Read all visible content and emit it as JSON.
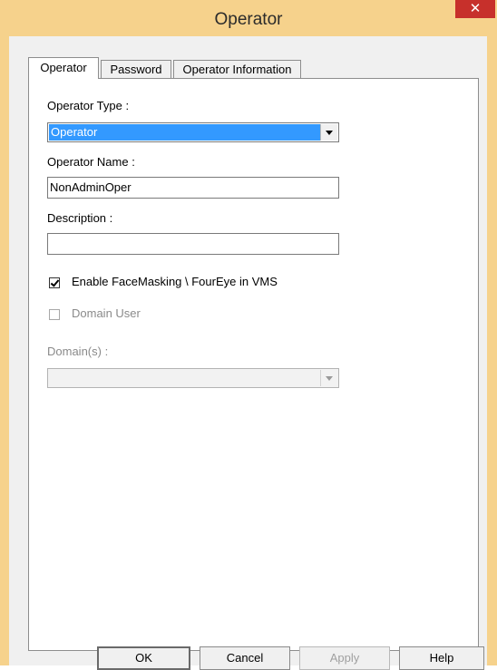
{
  "window": {
    "title": "Operator",
    "close_glyph": "✕"
  },
  "tabs": [
    {
      "label": "Operator",
      "active": true
    },
    {
      "label": "Password",
      "active": false
    },
    {
      "label": "Operator Information",
      "active": false
    }
  ],
  "form": {
    "operator_type": {
      "label": "Operator Type :",
      "value": "Operator"
    },
    "operator_name": {
      "label": "Operator Name :",
      "value": "NonAdminOper"
    },
    "description": {
      "label": "Description :",
      "value": ""
    },
    "face_masking": {
      "label": "Enable FaceMasking \\ FourEye in VMS",
      "checked": true
    },
    "domain_user": {
      "label": "Domain User",
      "checked": false,
      "enabled": false
    },
    "domains": {
      "label": "Domain(s) :",
      "value": "",
      "enabled": false
    }
  },
  "buttons": {
    "ok": "OK",
    "cancel": "Cancel",
    "apply": "Apply",
    "help": "Help"
  },
  "colors": {
    "title_bar": "#f6d28c",
    "close_button": "#c7302b",
    "selection": "#3399ff"
  }
}
